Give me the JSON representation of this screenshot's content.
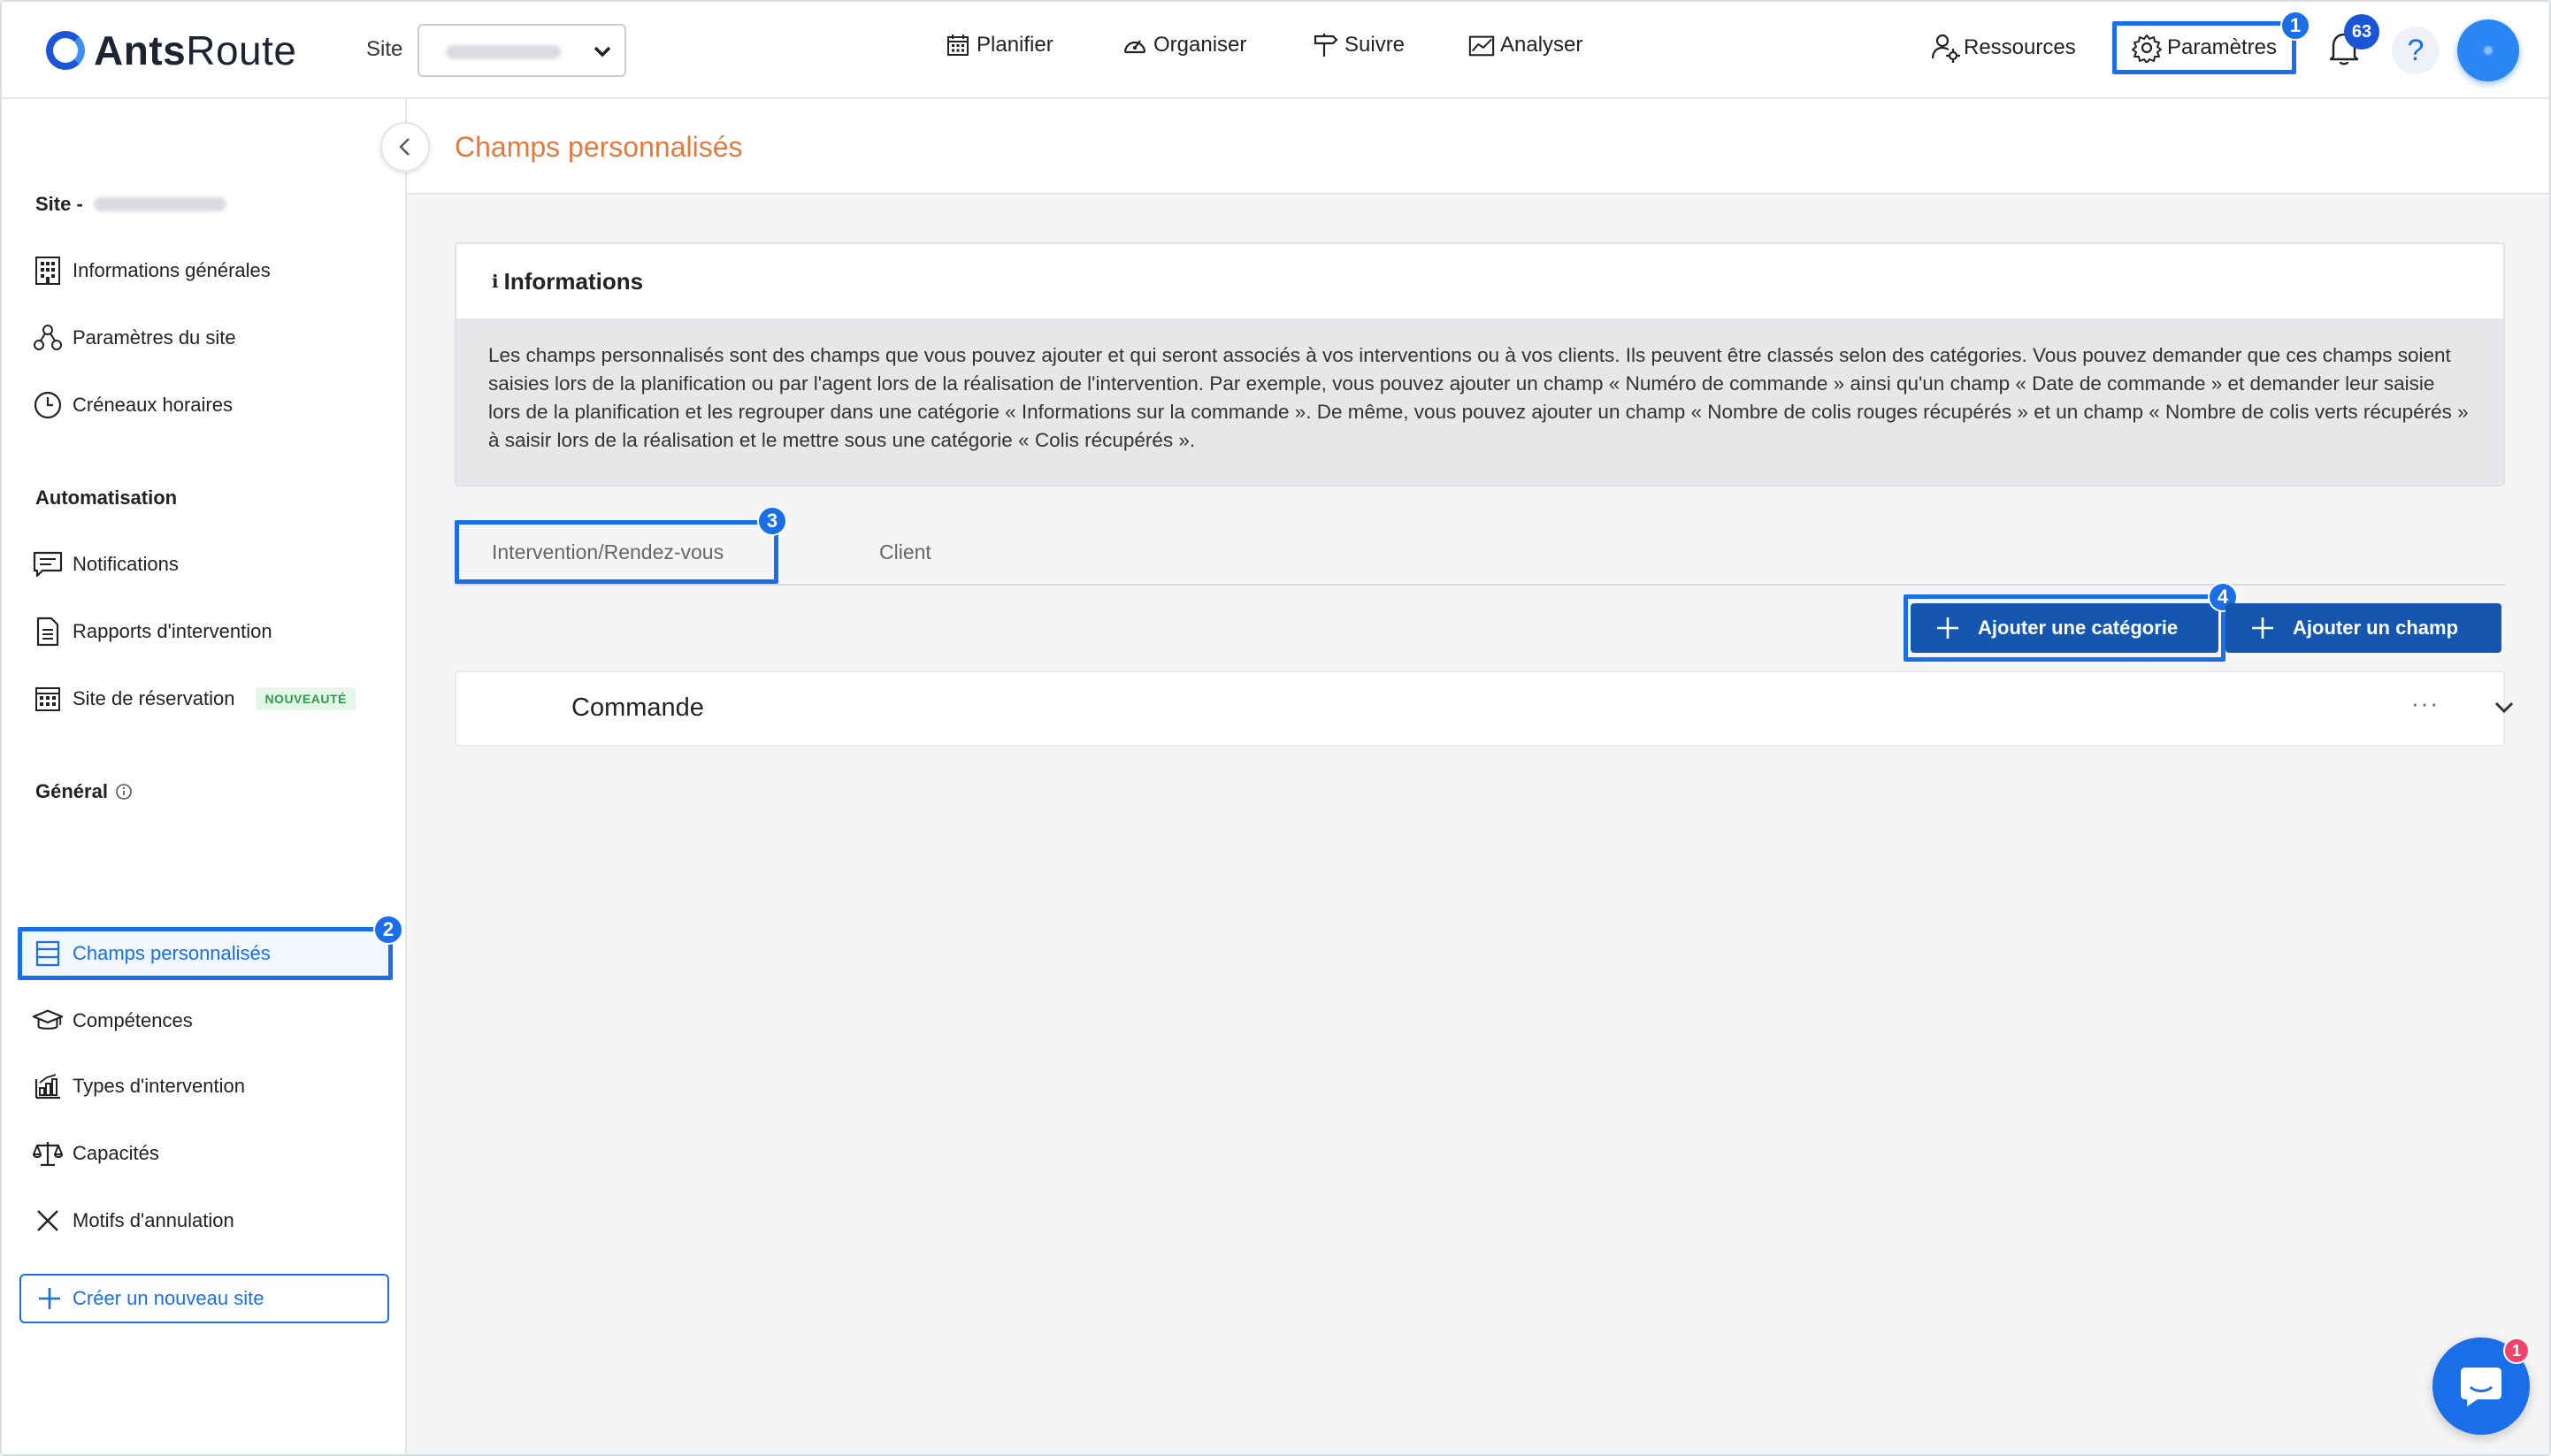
{
  "app": {
    "logo_bold": "Ants",
    "logo_light": "Route"
  },
  "header": {
    "site_label": "Site",
    "site_value": "",
    "nav": [
      {
        "label": "Planifier",
        "icon": "calendar-icon"
      },
      {
        "label": "Organiser",
        "icon": "speedometer-icon"
      },
      {
        "label": "Suivre",
        "icon": "signpost-icon"
      },
      {
        "label": "Analyser",
        "icon": "chart-icon"
      }
    ],
    "ressources_label": "Ressources",
    "parametres_label": "Paramètres",
    "notifications_count": "63",
    "help_label": "?"
  },
  "steps": {
    "s1": "1",
    "s2": "2",
    "s3": "3",
    "s4": "4"
  },
  "sidebar": {
    "site_section": "Site -",
    "site_items": [
      {
        "label": "Informations générales",
        "icon": "building-icon"
      },
      {
        "label": "Paramètres du site",
        "icon": "network-icon"
      },
      {
        "label": "Créneaux horaires",
        "icon": "clock-icon"
      }
    ],
    "automation_section": "Automatisation",
    "automation_items": [
      {
        "label": "Notifications",
        "icon": "message-icon"
      },
      {
        "label": "Rapports d'intervention",
        "icon": "document-icon"
      },
      {
        "label": "Site de réservation",
        "icon": "calendar-grid-icon",
        "badge": "NOUVEAUTÉ"
      }
    ],
    "general_section": "Général",
    "general_items": [
      {
        "label": "Champs personnalisés",
        "icon": "fields-icon"
      },
      {
        "label": "Compétences",
        "icon": "graduation-cap-icon"
      },
      {
        "label": "Types d'intervention",
        "icon": "types-icon"
      },
      {
        "label": "Capacités",
        "icon": "balance-icon"
      },
      {
        "label": "Motifs d'annulation",
        "icon": "x-icon"
      }
    ],
    "create_site_label": "Créer un nouveau site"
  },
  "main": {
    "page_title": "Champs personnalisés",
    "info": {
      "title": "Informations",
      "body": "Les champs personnalisés sont des champs que vous pouvez ajouter et qui seront associés à vos interventions ou à vos clients. Ils peuvent être classés selon des catégories. Vous pouvez demander que ces champs soient saisies lors de la planification ou par l'agent lors de la réalisation de l'intervention. Par exemple, vous pouvez ajouter un champ « Numéro de commande » ainsi qu'un champ « Date de commande » et demander leur saisie lors de la planification et les regrouper dans une catégorie « Informations sur la commande ». De même, vous pouvez ajouter un champ « Nombre de colis rouges récupérés » et un champ « Nombre de colis verts récupérés » à saisir lors de la réalisation et le mettre sous une catégorie « Colis récupérés »."
    },
    "tabs": [
      {
        "label": "Intervention/Rendez-vous"
      },
      {
        "label": "Client"
      }
    ],
    "add_category_label": "Ajouter une catégorie",
    "add_field_label": "Ajouter un champ",
    "categories": [
      {
        "name": "Commande",
        "more": "···"
      }
    ]
  },
  "chat": {
    "badge": "1"
  },
  "colors": {
    "primary": "#1557b0",
    "highlight": "#1a6fe8",
    "title_orange": "#e27a3f"
  }
}
